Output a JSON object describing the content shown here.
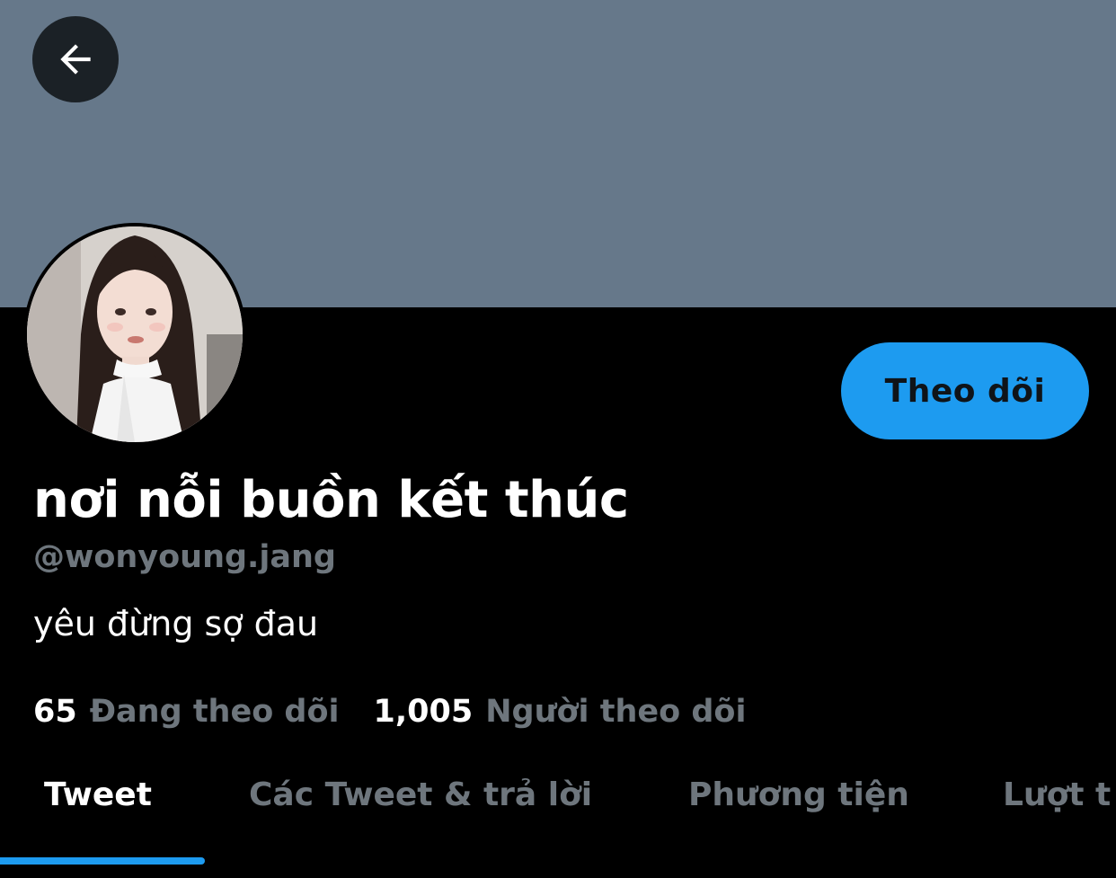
{
  "profile": {
    "display_name": "nơi nỗi buồn kết thúc",
    "handle": "@wonyoung.jang",
    "bio": "yêu đừng sợ đau",
    "follow_label": "Theo dõi"
  },
  "stats": {
    "following_count": "65",
    "following_label": "Đang theo dõi",
    "followers_count": "1,005",
    "followers_label": "Người theo dõi"
  },
  "tabs": [
    {
      "label": "Tweet",
      "active": true
    },
    {
      "label": "Các Tweet & trả lời",
      "active": false
    },
    {
      "label": "Phương tiện",
      "active": false
    },
    {
      "label": "Lượt t",
      "active": false
    }
  ],
  "icons": {
    "back": "arrow-left-icon"
  },
  "colors": {
    "banner": "#66788a",
    "accent": "#1d9bf0",
    "muted_text": "#6e767d",
    "background": "#000000"
  }
}
